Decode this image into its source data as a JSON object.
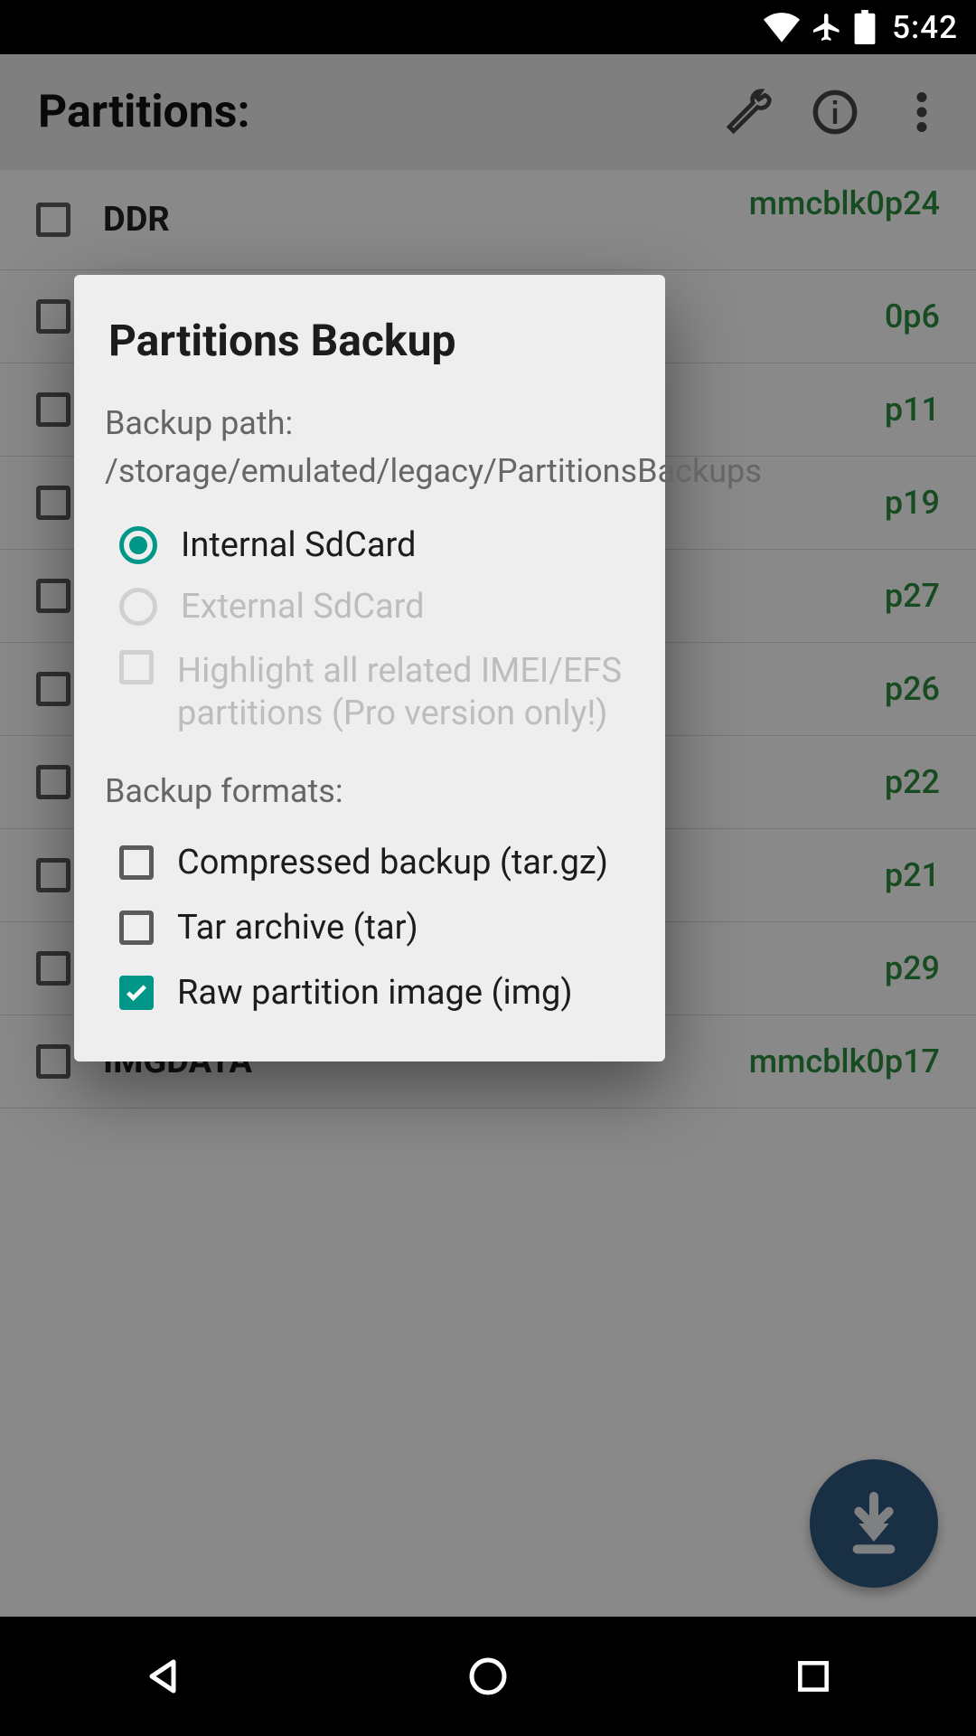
{
  "status": {
    "time": "5:42"
  },
  "appbar": {
    "title": "Partitions:"
  },
  "partitions": [
    {
      "name": "DDR",
      "dev": "mmcblk0p24"
    },
    {
      "name": "",
      "dev": "0p6"
    },
    {
      "name": "",
      "dev": "p11"
    },
    {
      "name": "",
      "dev": "p19"
    },
    {
      "name": "",
      "dev": "p27"
    },
    {
      "name": "",
      "dev": "p26"
    },
    {
      "name": "",
      "dev": "p22"
    },
    {
      "name": "",
      "dev": "p21"
    },
    {
      "name": "",
      "dev": "p29"
    },
    {
      "name": "IMGDATA",
      "dev": "mmcblk0p17"
    }
  ],
  "dialog": {
    "title": "Partitions Backup",
    "backup_path_label": "Backup path:",
    "backup_path_value": "/storage/emulated/legacy/PartitionsBackups",
    "storage": {
      "internal": "Internal SdCard",
      "external": "External SdCard"
    },
    "pro_option": "Highlight all related IMEI/EFS partitions (Pro version only!)",
    "formats_label": "Backup formats:",
    "formats": {
      "compressed": "Compressed backup (tar.gz)",
      "tar": "Tar archive (tar)",
      "raw": "Raw partition image (img)"
    }
  }
}
